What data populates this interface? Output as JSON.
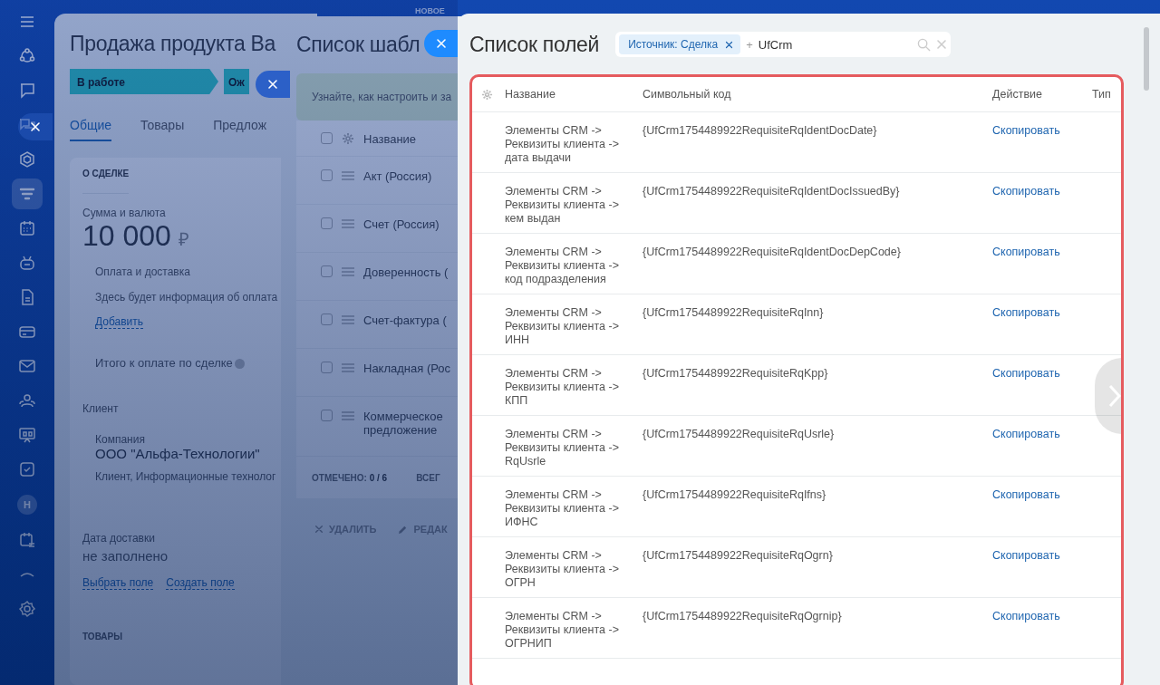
{
  "top_tab": "НОВОЕ",
  "sidebar": {
    "items": [
      {
        "kind": "menu",
        "selected": false
      },
      {
        "kind": "orbit",
        "selected": false
      },
      {
        "kind": "chat",
        "selected": false
      },
      {
        "kind": "bubbles",
        "selected": false
      },
      {
        "kind": "hexagon",
        "selected": false
      },
      {
        "kind": "funnel",
        "selected": true
      },
      {
        "kind": "calendar",
        "selected": false
      },
      {
        "kind": "robot",
        "selected": false
      },
      {
        "kind": "document",
        "selected": false
      },
      {
        "kind": "card",
        "selected": false
      },
      {
        "kind": "mail",
        "selected": false
      },
      {
        "kind": "people",
        "selected": false
      },
      {
        "kind": "board",
        "selected": false
      },
      {
        "kind": "checkbox",
        "selected": false
      },
      {
        "kind": "avatar",
        "text": "H",
        "selected": false
      },
      {
        "kind": "schedule",
        "selected": false
      },
      {
        "kind": "chevron",
        "selected": false
      },
      {
        "kind": "gear",
        "selected": false
      }
    ]
  },
  "deal_panel": {
    "title": "Продажа продукта Ва",
    "stages": [
      {
        "label": "В работе"
      },
      {
        "label": "Ож"
      }
    ],
    "tabs": [
      {
        "label": "Общие",
        "selected": true
      },
      {
        "label": "Товары",
        "selected": false
      },
      {
        "label": "Предлож",
        "selected": false
      }
    ],
    "section": "О СДЕЛКЕ",
    "amount_label": "Сумма и валюта",
    "amount": "10 000",
    "currency": "₽",
    "payment_title": "Оплата и доставка",
    "payment_text": "Здесь будет информация об оплата",
    "add_link": "Добавить",
    "total_label": "Итого к оплате по сделке",
    "client_label": "Клиент",
    "company_label": "Компания",
    "company": "ООО \"Альфа-Технологии\"",
    "company_tags": "Клиент, Информационные технолог",
    "delivery_label": "Дата доставки",
    "delivery_value": "не заполнено",
    "links": [
      "Выбрать поле",
      "Создать поле"
    ],
    "products": "ТОВАРЫ"
  },
  "templates_panel": {
    "title": "Список шабл",
    "hint": "Узнайте, как настроить и за",
    "column": "Название",
    "all_checked": false,
    "rows": [
      {
        "name": "Акт (Россия)",
        "checked": false
      },
      {
        "name": "Счет (Россия)",
        "checked": false
      },
      {
        "name": "Доверенность (",
        "checked": false
      },
      {
        "name": "Счет-фактура (",
        "checked": false
      },
      {
        "name": "Накладная (Рос",
        "checked": false
      },
      {
        "name": "Коммерческое предложение",
        "checked": false
      }
    ],
    "selected_label": "ОТМЕЧЕНО:",
    "selected_count": "0 / 6",
    "total_label": "ВСЕГ",
    "actions": [
      "УДАЛИТЬ",
      "РЕДАК"
    ]
  },
  "fields_panel": {
    "title": "Список полей",
    "filter_chip": "Источник: Сделка",
    "plus": "+",
    "search_value": "UfCrm",
    "columns": [
      "Название",
      "Символьный код",
      "Действие",
      "Тип"
    ],
    "rows": [
      {
        "name": "Элементы CRM -> Реквизиты клиента -> дата выдачи",
        "code": "{UfCrm1754489922RequisiteRqIdentDocDate}",
        "action": "Скопировать"
      },
      {
        "name": "Элементы CRM -> Реквизиты клиента -> кем выдан",
        "code": "{UfCrm1754489922RequisiteRqIdentDocIssuedBy}",
        "action": "Скопировать"
      },
      {
        "name": "Элементы CRM -> Реквизиты клиента -> код подразделения",
        "code": "{UfCrm1754489922RequisiteRqIdentDocDepCode}",
        "action": "Скопировать"
      },
      {
        "name": "Элементы CRM -> Реквизиты клиента -> ИНН",
        "code": "{UfCrm1754489922RequisiteRqInn}",
        "action": "Скопировать"
      },
      {
        "name": "Элементы CRM -> Реквизиты клиента -> КПП",
        "code": "{UfCrm1754489922RequisiteRqKpp}",
        "action": "Скопировать"
      },
      {
        "name": "Элементы CRM -> Реквизиты клиента -> RqUsrle",
        "code": "{UfCrm1754489922RequisiteRqUsrle}",
        "action": "Скопировать"
      },
      {
        "name": "Элементы CRM -> Реквизиты клиента -> ИФНС",
        "code": "{UfCrm1754489922RequisiteRqIfns}",
        "action": "Скопировать"
      },
      {
        "name": "Элементы CRM -> Реквизиты клиента -> ОГРН",
        "code": "{UfCrm1754489922RequisiteRqOgrn}",
        "action": "Скопировать"
      },
      {
        "name": "Элементы CRM -> Реквизиты клиента -> ОГРНИП",
        "code": "{UfCrm1754489922RequisiteRqOgrnip}",
        "action": "Скопировать"
      }
    ]
  }
}
